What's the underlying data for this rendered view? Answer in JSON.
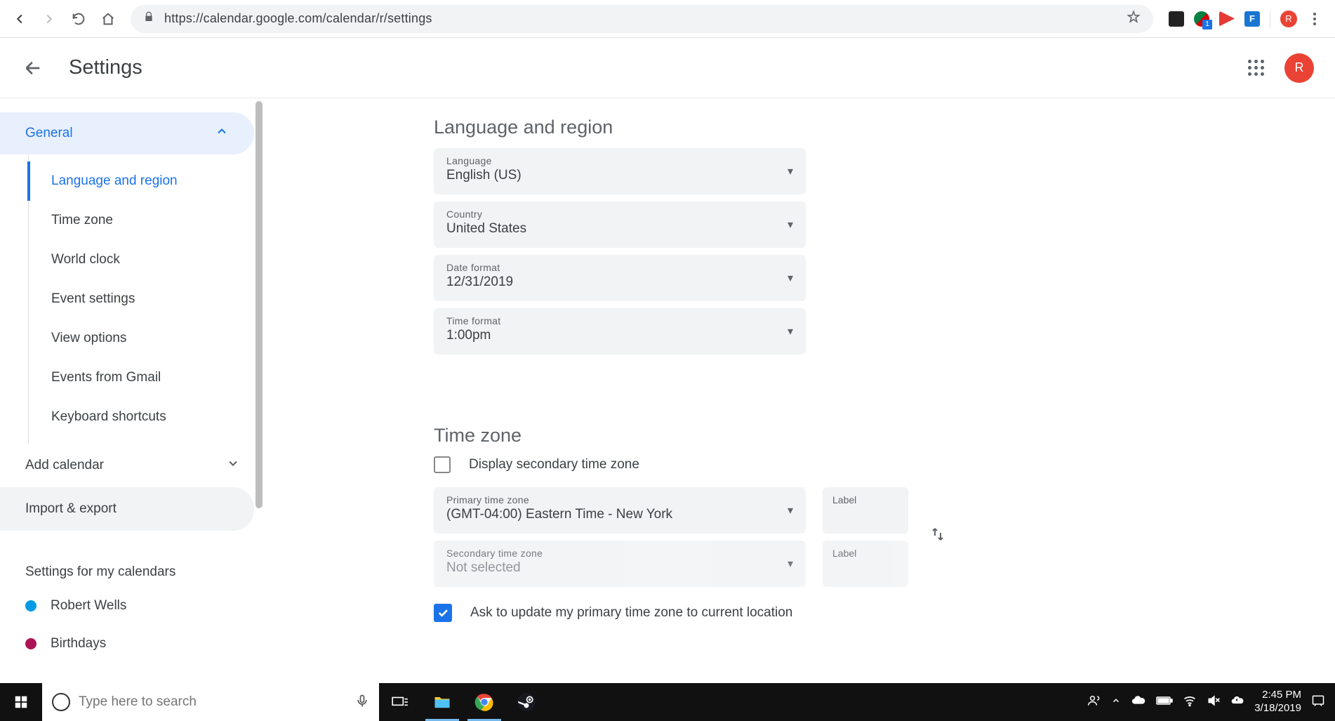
{
  "browser": {
    "url": "https://calendar.google.com/calendar/r/settings",
    "extension_badge": "1",
    "profile_letter": "R"
  },
  "header": {
    "title": "Settings",
    "avatar_letter": "R"
  },
  "sidebar": {
    "general_label": "General",
    "general_items": [
      "Language and region",
      "Time zone",
      "World clock",
      "Event settings",
      "View options",
      "Events from Gmail",
      "Keyboard shortcuts"
    ],
    "add_calendar": "Add calendar",
    "import_export": "Import & export",
    "my_calendars_title": "Settings for my calendars",
    "my_calendars": [
      {
        "name": "Robert Wells",
        "color": "#039be5"
      },
      {
        "name": "Birthdays",
        "color": "#ad1457"
      }
    ]
  },
  "content": {
    "lang_region": {
      "title": "Language and region",
      "language_label": "Language",
      "language_value": "English (US)",
      "country_label": "Country",
      "country_value": "United States",
      "date_format_label": "Date format",
      "date_format_value": "12/31/2019",
      "time_format_label": "Time format",
      "time_format_value": "1:00pm"
    },
    "time_zone": {
      "title": "Time zone",
      "display_secondary_label": "Display secondary time zone",
      "display_secondary_checked": false,
      "primary_label": "Primary time zone",
      "primary_value": "(GMT-04:00) Eastern Time - New York",
      "secondary_label": "Secondary time zone",
      "secondary_value": "Not selected",
      "label_field": "Label",
      "ask_update_label": "Ask to update my primary time zone to current location",
      "ask_update_checked": true
    }
  },
  "taskbar": {
    "search_placeholder": "Type here to search",
    "time": "2:45 PM",
    "date": "3/18/2019"
  }
}
